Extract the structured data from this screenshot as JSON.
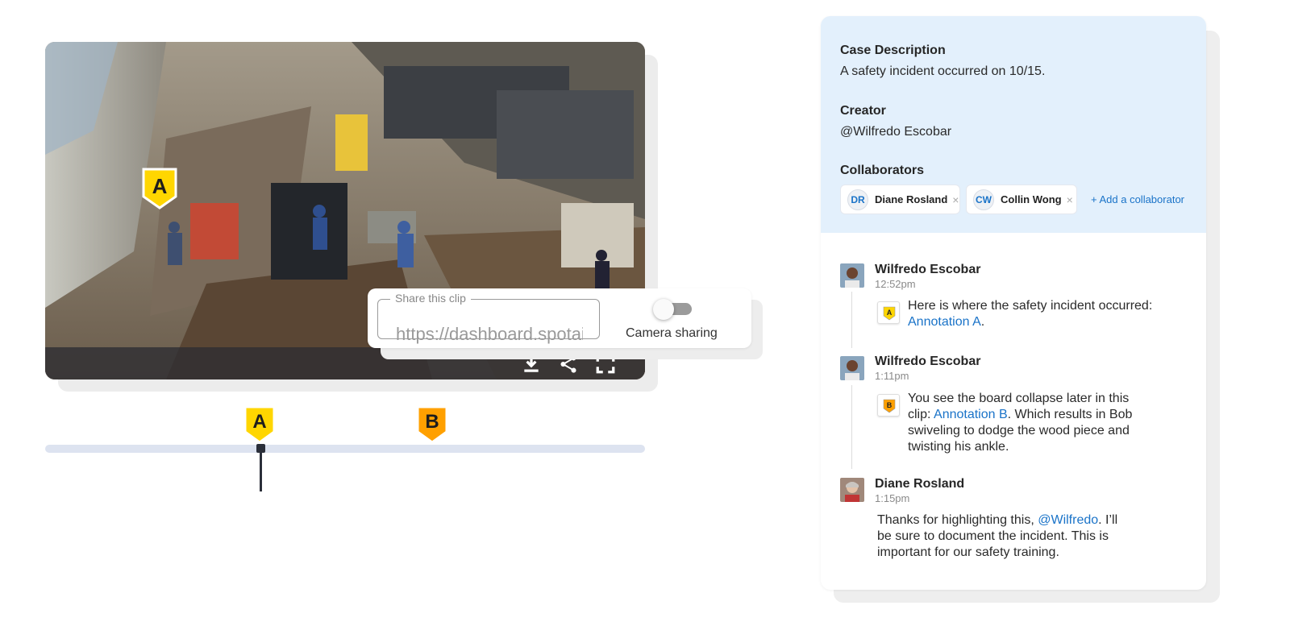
{
  "video": {
    "image_description": "factory floor with workers",
    "markers": [
      {
        "letter": "A",
        "color": "#ffd600"
      }
    ],
    "controls": [
      "download-icon",
      "share-icon",
      "fullscreen-icon"
    ]
  },
  "share": {
    "legend": "Share this clip",
    "url_value": "https://dashboard.spotai",
    "toggle_label": "Camera sharing",
    "toggle_on": false
  },
  "timeline": {
    "markers": [
      {
        "letter": "A",
        "color": "#ffd600"
      },
      {
        "letter": "B",
        "color": "#ffa000"
      }
    ]
  },
  "case": {
    "description_label": "Case Description",
    "description": "A safety incident occurred on 10/15.",
    "creator_label": "Creator",
    "creator": "@Wilfredo Escobar",
    "collaborators_label": "Collaborators",
    "collaborators": [
      {
        "initials": "DR",
        "name": "Diane Rosland"
      },
      {
        "initials": "CW",
        "name": "Collin Wong"
      }
    ],
    "add_collaborator": "+ Add a collaborator",
    "remove_glyph": "×"
  },
  "messages": [
    {
      "author": "Wilfredo Escobar",
      "time": "12:52pm",
      "marker": "A",
      "text_before": "Here is where the safety incident occurred: ",
      "link": "Annotation A",
      "text_after": "."
    },
    {
      "author": "Wilfredo Escobar",
      "time": "1:11pm",
      "marker": "B",
      "text_before": "You see the board collapse later in this clip: ",
      "link": "Annotation B",
      "text_after": ". Which results in Bob swiveling to dodge the wood piece and twisting his ankle."
    },
    {
      "author": "Diane Rosland",
      "time": "1:15pm",
      "text_before": "Thanks for highlighting this, ",
      "link": "@Wilfredo",
      "text_after": ". I’ll be sure to document the incident. This is important for our safety training."
    }
  ],
  "colors": {
    "accent": "#1a73c8",
    "marker_a": "#ffd600",
    "marker_b": "#ffa000",
    "case_bg": "#e3f0fc"
  }
}
